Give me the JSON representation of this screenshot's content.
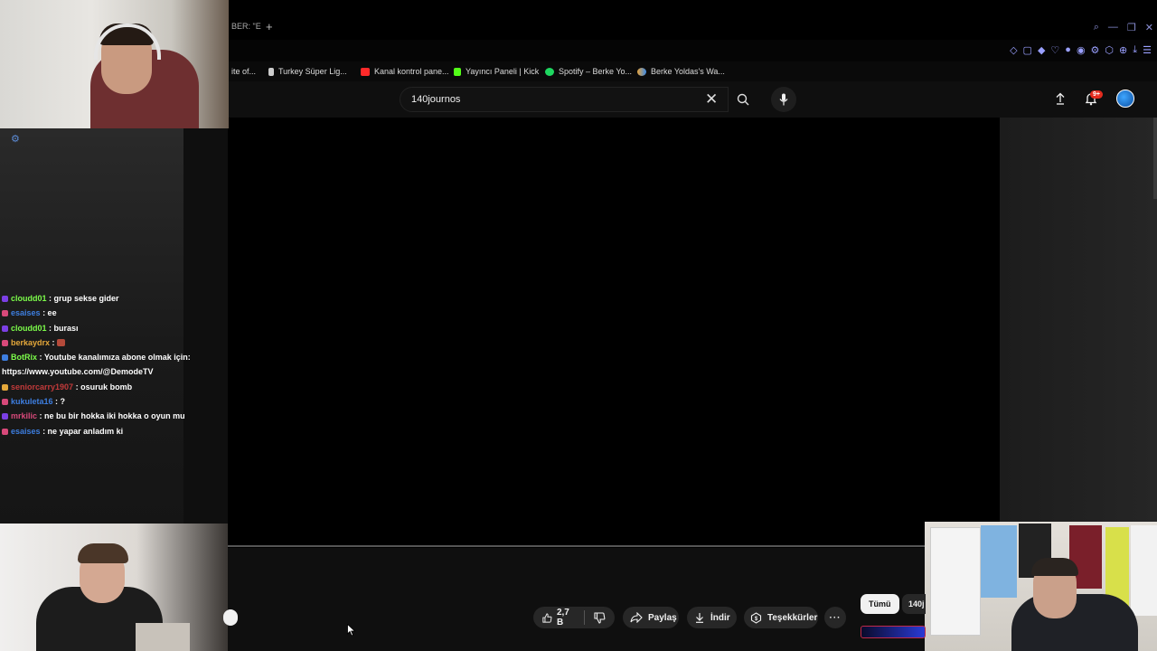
{
  "browser": {
    "tab_fragment": "BER: \"E",
    "new_tab_glyph": "+",
    "window_controls": [
      "⌕",
      "—",
      "❐",
      "✕"
    ],
    "extension_icons": [
      "◇",
      "▢",
      "◆",
      "♡",
      "●",
      "◉",
      "⚙",
      "⬡",
      "⊕",
      "⤓",
      "☰"
    ],
    "bookmarks": [
      {
        "label": "ite of...",
        "color": "transparent"
      },
      {
        "label": "Turkey Süper Lig...",
        "color": "#cccccc"
      },
      {
        "label": "Kanal kontrol pane...",
        "color": "#ff2a2a"
      },
      {
        "label": "Yayıncı Paneli | Kick",
        "color": "#53fc18"
      },
      {
        "label": "Spotify – Berke Yo...",
        "color": "#1ed760"
      },
      {
        "label": "Berke Yoldas's Wa...",
        "color": "#e8a33a"
      }
    ]
  },
  "youtube": {
    "search": {
      "value": "140journos"
    },
    "notification_badge": "9+"
  },
  "chat": {
    "settings_icon": "⚙",
    "messages": [
      {
        "user": "cloudd01",
        "user_class": "u-green",
        "badge_color": "#7b3fe4",
        "text": ": grup sekse gider"
      },
      {
        "user": "esaises",
        "user_class": "u-blue",
        "badge_color": "#d8497a",
        "text": ": ee"
      },
      {
        "user": "cloudd01",
        "user_class": "u-green",
        "badge_color": "#7b3fe4",
        "text": ": burası"
      },
      {
        "user": "berkaydrx",
        "user_class": "u-orange",
        "badge_color": "#d8497a",
        "text": ":",
        "emote": true
      },
      {
        "user": "BotRix",
        "user_class": "u-green",
        "badge_color": "#3d7ee0",
        "text": ": Youtube kanalımıza abone olmak için:"
      },
      {
        "user": "",
        "user_class": "",
        "badge_color": "",
        "text": "https://www.youtube.com/@DemodeTV"
      },
      {
        "user": "seniorcarry1907",
        "user_class": "u-red",
        "badge_color": "#e5a83a",
        "text": ": osuruk bomb"
      },
      {
        "user": "kukuleta16",
        "user_class": "u-blue",
        "badge_color": "#d8497a",
        "text": ": ?"
      },
      {
        "user": "mrkilic",
        "user_class": "u-pink",
        "badge_color": "#7b3fe4",
        "text": ": ne bu bir hokka iki hokka o oyun mu"
      },
      {
        "user": "esaises",
        "user_class": "u-blue",
        "badge_color": "#d8497a",
        "text": ": ne yapar anladım ki"
      }
    ]
  },
  "actions": {
    "likes": "2,7 B",
    "share": "Paylaş",
    "download": "İndir",
    "thanks": "Teşekkürler",
    "more": "···"
  },
  "chips": [
    "Tümü",
    "140j"
  ]
}
